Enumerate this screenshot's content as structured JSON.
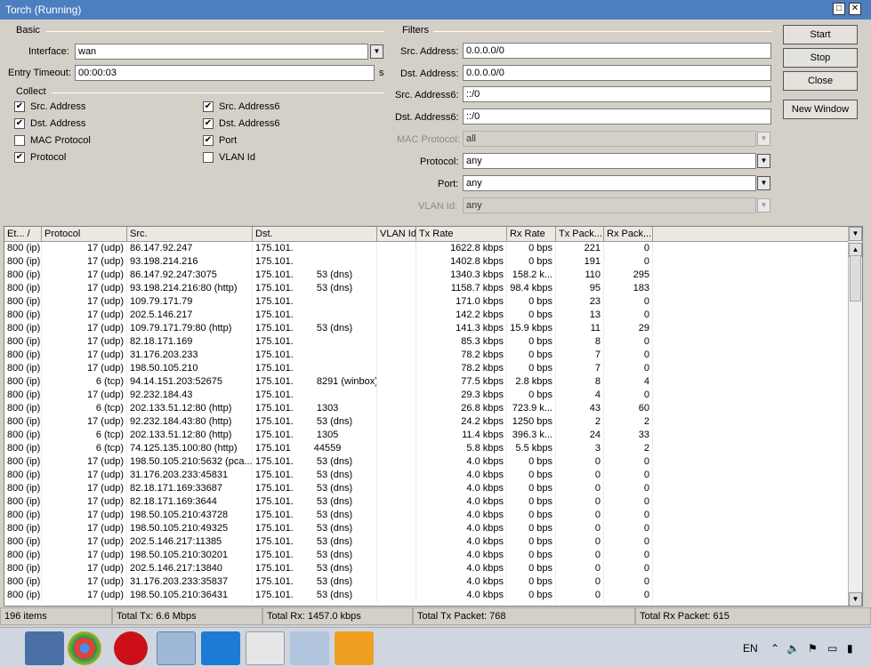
{
  "window": {
    "title": "Torch (Running)",
    "max_icon": "maximize-icon",
    "close_icon": "close-icon"
  },
  "basic": {
    "group_label": "Basic",
    "interface_label": "Interface:",
    "interface_value": "wan",
    "entry_timeout_label": "Entry Timeout:",
    "entry_timeout_value": "00:00:03",
    "entry_timeout_unit": "s"
  },
  "collect": {
    "group_label": "Collect",
    "items": [
      {
        "label": "Src. Address",
        "checked": true
      },
      {
        "label": "Dst. Address",
        "checked": true
      },
      {
        "label": "MAC Protocol",
        "checked": false
      },
      {
        "label": "Protocol",
        "checked": true
      },
      {
        "label": "Src. Address6",
        "checked": true
      },
      {
        "label": "Dst. Address6",
        "checked": true
      },
      {
        "label": "Port",
        "checked": true
      },
      {
        "label": "VLAN Id",
        "checked": false
      }
    ]
  },
  "filters": {
    "group_label": "Filters",
    "src_address_label": "Src. Address:",
    "src_address_value": "0.0.0.0/0",
    "dst_address_label": "Dst. Address:",
    "dst_address_value": "0.0.0.0/0",
    "src_address6_label": "Src. Address6:",
    "src_address6_value": "::/0",
    "dst_address6_label": "Dst. Address6:",
    "dst_address6_value": "::/0",
    "mac_protocol_label": "MAC Protocol:",
    "mac_protocol_value": "all",
    "protocol_label": "Protocol:",
    "protocol_value": "any",
    "port_label": "Port:",
    "port_value": "any",
    "vlan_label": "VLAN Id:",
    "vlan_value": "any"
  },
  "buttons": {
    "start": "Start",
    "stop": "Stop",
    "close": "Close",
    "new_window": "New Window"
  },
  "table": {
    "headers": [
      "Et... /",
      "Protocol",
      "Src.",
      "Dst.",
      "VLAN Id",
      "Tx Rate",
      "Rx Rate",
      "Tx Pack...",
      "Rx Pack..."
    ],
    "rows": [
      [
        "800 (ip)",
        "17 (udp)",
        "86.147.92.247",
        "175.101.",
        "",
        "1622.8 kbps",
        "0 bps",
        "221",
        "0"
      ],
      [
        "800 (ip)",
        "17 (udp)",
        "93.198.214.216",
        "175.101.",
        "",
        "1402.8 kbps",
        "0 bps",
        "191",
        "0"
      ],
      [
        "800 (ip)",
        "17 (udp)",
        "86.147.92.247:3075",
        "175.101.",
        "",
        "1340.3 kbps",
        "158.2 k...",
        "110",
        "295"
      ],
      [
        "800 (ip)",
        "17 (udp)",
        "93.198.214.216:80 (http)",
        "175.101.",
        "",
        "1158.7 kbps",
        "98.4 kbps",
        "95",
        "183"
      ],
      [
        "800 (ip)",
        "17 (udp)",
        "109.79.171.79",
        "175.101.",
        "",
        "171.0 kbps",
        "0 bps",
        "23",
        "0"
      ],
      [
        "800 (ip)",
        "17 (udp)",
        "202.5.146.217",
        "175.101.",
        "",
        "142.2 kbps",
        "0 bps",
        "13",
        "0"
      ],
      [
        "800 (ip)",
        "17 (udp)",
        "109.79.171.79:80 (http)",
        "175.101.",
        "",
        "141.3 kbps",
        "15.9 kbps",
        "11",
        "29"
      ],
      [
        "800 (ip)",
        "17 (udp)",
        "82.18.171.169",
        "175.101.",
        "",
        "85.3 kbps",
        "0 bps",
        "8",
        "0"
      ],
      [
        "800 (ip)",
        "17 (udp)",
        "31.176.203.233",
        "175.101.",
        "",
        "78.2 kbps",
        "0 bps",
        "7",
        "0"
      ],
      [
        "800 (ip)",
        "17 (udp)",
        "198.50.105.210",
        "175.101.",
        "",
        "78.2 kbps",
        "0 bps",
        "7",
        "0"
      ],
      [
        "800 (ip)",
        "6 (tcp)",
        "94.14.151.203:52675",
        "175.101.",
        "",
        "77.5 kbps",
        "2.8 kbps",
        "8",
        "4"
      ],
      [
        "800 (ip)",
        "17 (udp)",
        "92.232.184.43",
        "175.101.",
        "",
        "29.3 kbps",
        "0 bps",
        "4",
        "0"
      ],
      [
        "800 (ip)",
        "6 (tcp)",
        "202.133.51.12:80 (http)",
        "175.101.",
        "",
        "26.8 kbps",
        "723.9 k...",
        "43",
        "60"
      ],
      [
        "800 (ip)",
        "17 (udp)",
        "92.232.184.43:80 (http)",
        "175.101.",
        "",
        "24.2 kbps",
        "1250 bps",
        "2",
        "2"
      ],
      [
        "800 (ip)",
        "6 (tcp)",
        "202.133.51.12:80 (http)",
        "175.101.",
        "",
        "11.4 kbps",
        "396.3 k...",
        "24",
        "33"
      ],
      [
        "800 (ip)",
        "6 (tcp)",
        "74.125.135.100:80 (http)",
        "175.101",
        "",
        "5.8 kbps",
        "5.5 kbps",
        "3",
        "2"
      ],
      [
        "800 (ip)",
        "17 (udp)",
        "198.50.105.210:5632 (pca...",
        "175.101.",
        "",
        "4.0 kbps",
        "0 bps",
        "0",
        "0"
      ],
      [
        "800 (ip)",
        "17 (udp)",
        "31.176.203.233:45831",
        "175.101.",
        "",
        "4.0 kbps",
        "0 bps",
        "0",
        "0"
      ],
      [
        "800 (ip)",
        "17 (udp)",
        "82.18.171.169:33687",
        "175.101.",
        "",
        "4.0 kbps",
        "0 bps",
        "0",
        "0"
      ],
      [
        "800 (ip)",
        "17 (udp)",
        "82.18.171.169:3644",
        "175.101.",
        "",
        "4.0 kbps",
        "0 bps",
        "0",
        "0"
      ],
      [
        "800 (ip)",
        "17 (udp)",
        "198.50.105.210:43728",
        "175.101.",
        "",
        "4.0 kbps",
        "0 bps",
        "0",
        "0"
      ],
      [
        "800 (ip)",
        "17 (udp)",
        "198.50.105.210:49325",
        "175.101.",
        "",
        "4.0 kbps",
        "0 bps",
        "0",
        "0"
      ],
      [
        "800 (ip)",
        "17 (udp)",
        "202.5.146.217:11385",
        "175.101.",
        "",
        "4.0 kbps",
        "0 bps",
        "0",
        "0"
      ],
      [
        "800 (ip)",
        "17 (udp)",
        "198.50.105.210:30201",
        "175.101.",
        "",
        "4.0 kbps",
        "0 bps",
        "0",
        "0"
      ],
      [
        "800 (ip)",
        "17 (udp)",
        "202.5.146.217:13840",
        "175.101.",
        "",
        "4.0 kbps",
        "0 bps",
        "0",
        "0"
      ],
      [
        "800 (ip)",
        "17 (udp)",
        "31.176.203.233:35837",
        "175.101.",
        "",
        "4.0 kbps",
        "0 bps",
        "0",
        "0"
      ],
      [
        "800 (ip)",
        "17 (udp)",
        "198.50.105.210:36431",
        "175.101.",
        "",
        "4.0 kbps",
        "0 bps",
        "0",
        "0"
      ]
    ],
    "dst_suffixes": [
      "",
      "",
      "53 (dns)",
      "53 (dns)",
      "",
      "",
      "53 (dns)",
      "",
      "",
      "",
      "8291 (winbox)",
      "",
      "1303",
      "53 (dns)",
      "1305",
      "44559",
      "53 (dns)",
      "53 (dns)",
      "53 (dns)",
      "53 (dns)",
      "53 (dns)",
      "53 (dns)",
      "53 (dns)",
      "53 (dns)",
      "53 (dns)",
      "53 (dns)",
      "53 (dns)"
    ]
  },
  "status": {
    "items": "196 items",
    "total_tx": "Total Tx: 6.6 Mbps",
    "total_rx": "Total Rx: 1457.0 kbps",
    "total_tx_packet": "Total Tx Packet: 768",
    "total_rx_packet": "Total Rx Packet: 615"
  },
  "taskbar": {
    "apps": [
      "network-icon",
      "chrome-icon",
      "opera-icon",
      "winbox-icon",
      "teamviewer-icon",
      "vnc-icon",
      "calculator-icon",
      "outlook-icon"
    ],
    "lang": "EN"
  },
  "colors": {
    "titlebar": "#4c7fbf",
    "window_bg": "#d4d0c8",
    "taskbar": "#cfd6df"
  }
}
